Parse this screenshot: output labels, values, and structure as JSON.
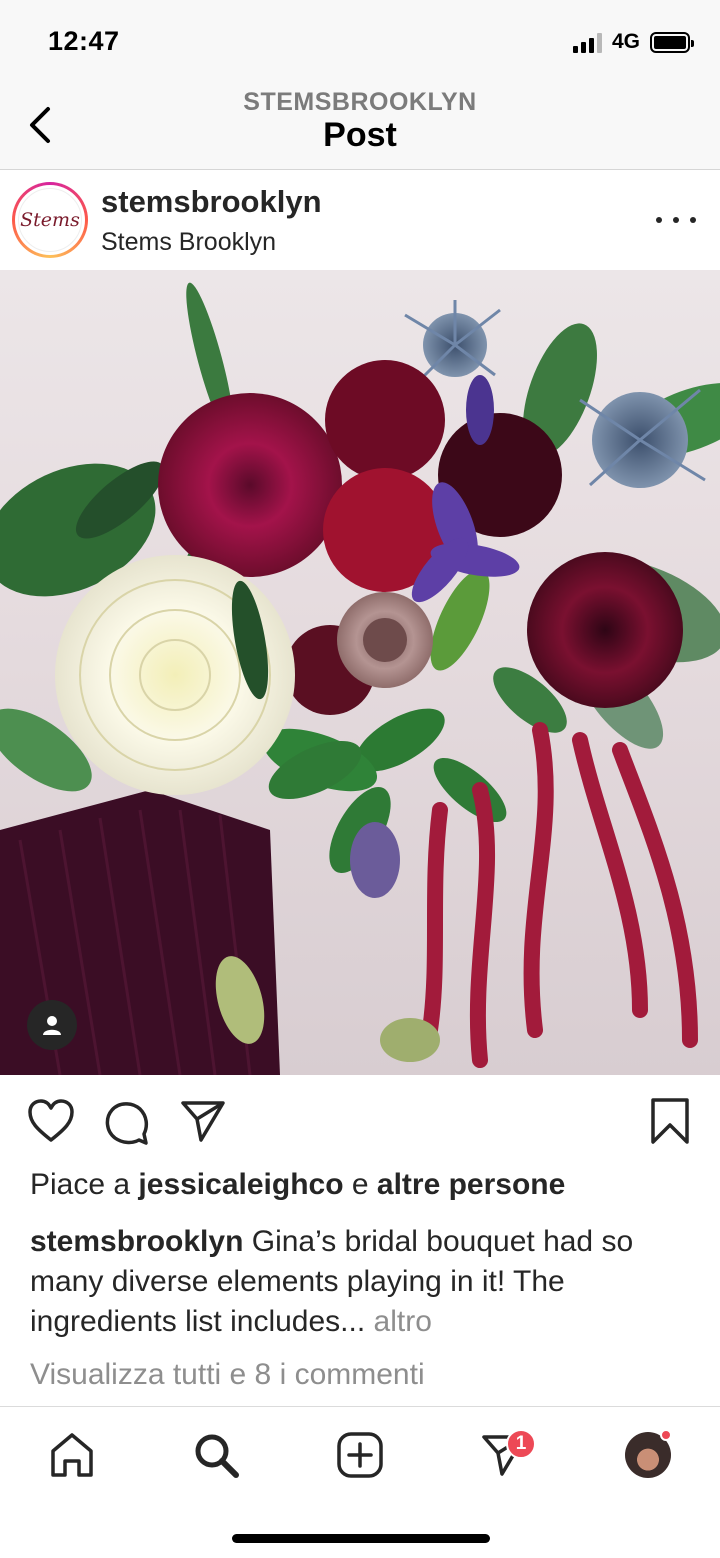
{
  "status_bar": {
    "time": "12:47",
    "network": "4G"
  },
  "header": {
    "account": "STEMSBROOKLYN",
    "title": "Post"
  },
  "post": {
    "username": "stemsbrooklyn",
    "location": "Stems Brooklyn",
    "avatar_text": "Stems",
    "likes": {
      "prefix": "Piace a",
      "liker": "jessicaleighco",
      "connector": "e",
      "others": "altre persone"
    },
    "caption": {
      "username": "stemsbrooklyn",
      "text": "Gina’s bridal bouquet had so many diverse elements playing in it! The ingredients list includes...",
      "more": "altro"
    },
    "view_comments": "Visualizza tutti e 8 i commenti"
  },
  "tab_bar": {
    "direct_badge": "1"
  },
  "colors": {
    "text": "#262626",
    "muted": "#8e8e8e",
    "notification": "#ed4956"
  }
}
